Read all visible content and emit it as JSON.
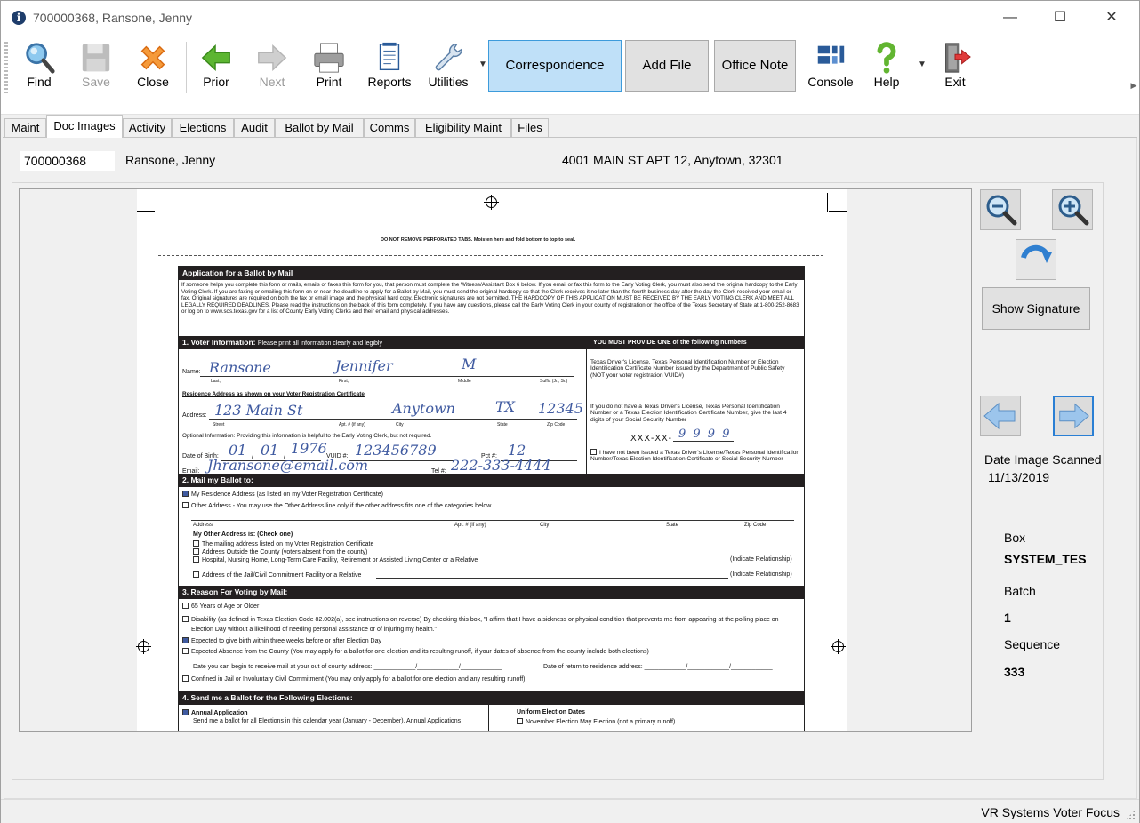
{
  "window": {
    "title": "700000368, Ransone, Jenny",
    "controls": {
      "minimize": "—",
      "maximize": "☐",
      "close": "✕"
    }
  },
  "toolbar": {
    "find": "Find",
    "save": "Save",
    "close": "Close",
    "prior": "Prior",
    "next": "Next",
    "print": "Print",
    "reports": "Reports",
    "utilities": "Utilities",
    "correspondence": "Correspondence",
    "add_file": "Add File",
    "office_note": "Office Note",
    "console": "Console",
    "help": "Help",
    "exit": "Exit"
  },
  "tabs": [
    "Maint",
    "Doc Images",
    "Activity",
    "Elections",
    "Audit",
    "Ballot by Mail",
    "Comms",
    "Eligibility Maint",
    "Files"
  ],
  "active_tab": "Doc Images",
  "voter": {
    "id": "700000368",
    "name": "Ransone, Jenny",
    "address": "4001 MAIN ST APT 12, Anytown, 32301"
  },
  "document": {
    "perforation_note": "DO NOT REMOVE PERFORATED TABS. Moisten here and fold bottom to top to seal.",
    "title": "Application for a Ballot by Mail",
    "intro": "If someone helps you complete this form or mails, emails or faxes this form for you, that person must complete the Witness/Assistant Box 6 below. If you email or fax this form to the Early Voting Clerk, you must also send the original hardcopy to the Early Voting Clerk. If you are faxing or emailing this form on or near the deadline to apply for a Ballot by Mail, you must send the original hardcopy so that the Clerk receives it no later than the fourth business day after the day the Clerk received your email or fax. Original signatures are required on both the fax or email image and the physical hard copy. Electronic signatures are not permitted. THE HARDCOPY OF THIS APPLICATION MUST BE RECEIVED BY THE EARLY VOTING CLERK AND MEET ALL LEGALLY REQUIRED DEADLINES. Please read the instructions on the back of this form completely. If you have any questions, please call the Early Voting Clerk in your county of registration or the office of the Texas Secretary of State at 1-800-252-8683 or log on to www.sos.texas.gov for a list of County Early Voting Clerks and their email and physical addresses.",
    "section1": "1. Voter Information:",
    "section1_note": "Please print all information clearly and legibly",
    "must_provide": "YOU MUST PROVIDE ONE of the following numbers",
    "name_label": "Name:",
    "name_last": "Ransone",
    "name_first": "Jennifer",
    "name_middle": "M",
    "name_sub": [
      "Last,",
      "First,",
      "Middle",
      "Suffix (Jr., Sr.)"
    ],
    "residence_label": "Residence Address as shown on your Voter Registration Certificate",
    "address_label": "Address:",
    "addr_street": "123 Main St",
    "addr_city": "Anytown",
    "addr_state": "TX",
    "addr_zip": "12345",
    "addr_sub": [
      "Street",
      "Apt. # (if any)",
      "City",
      "State",
      "Zip Code"
    ],
    "optional_info": "Optional Information: Providing this information is helpful to the Early Voting Clerk, but not required.",
    "dob_label": "Date of Birth:",
    "dob_m": "01",
    "dob_d": "01",
    "dob_y": "1976",
    "vuid_label": "VUID #:",
    "vuid": "123456789",
    "pct_label": "Pct #:",
    "pct": "12",
    "email_label": "Email:",
    "email": "Jhransone@email.com",
    "tel_label": "Tel #:",
    "tel": "222-333-4444",
    "dl_text": "Texas Driver's License, Texas Personal Identification Number or Election Identification Certificate Number issued by the Department of Public Safety (NOT your voter registration VUID#)",
    "dl_dashes": "__ __ __ __ __ __ __ __",
    "ssn_text": "If you do not have a Texas Driver's License, Texas Personal Identification Number or a Texas Election Identification Certificate Number, give the last 4 digits of your Social Security Number",
    "ssn_prefix": "XXX-XX-",
    "ssn": "9 9 9 9",
    "no_id_text": "I have not been issued a Texas Driver's License/Texas Personal Identification Number/Texas Election Identification Certificate or Social Security Number",
    "section2": "2. Mail my Ballot to:",
    "mail_opt1": "My Residence Address (as listed on my Voter Registration Certificate)",
    "mail_opt2": "Other Address - You may use the Other Address line only if the other address fits one of the categories below.",
    "other_sub": [
      "Address",
      "Apt. # (if any)",
      "City",
      "State",
      "Zip Code"
    ],
    "other_title": "My Other Address is: (Check one)",
    "other_opts": [
      "The mailing address listed on my Voter Registration Certificate",
      "Address Outside the County (voters absent from the county)",
      "Hospital, Nursing Home, Long-Term Care Facility, Retirement or Assisted Living Center or a Relative",
      "Address of the Jail/Civil Commitment Facility or a Relative"
    ],
    "indicate": "(Indicate Relationship)",
    "section3": "3. Reason For Voting by Mail:",
    "reasons": [
      "65 Years of Age or Older",
      "Disability (as defined in Texas Election Code 82.002(a), see instructions on reverse) By checking this box, \"I affirm that I have a sickness or physical condition that prevents me from appearing at the polling place on Election Day without a likelihood of needing personal assistance or of injuring my health.\"",
      "Expected to give birth within three weeks before or after Election Day",
      "Expected Absence from the County (You may apply for a ballot for one election and its resulting runoff, if your dates of absence from the county include both elections)"
    ],
    "date_begin": "Date you can begin to receive mail at your out of county address: ____________/____________/____________",
    "date_return": "Date of return to residence address: ____________/____________/____________",
    "confined": "Confined in Jail or Involuntary Civil Commitment (You may only apply for a ballot for one election and any resulting runoff)",
    "section4": "4. Send me a Ballot for the Following Elections:",
    "annual": "Annual Application",
    "annual_cut": "Send me a ballot for all Elections in this calendar year (January - December). Annual Applications",
    "uniform": "Uniform Election Dates",
    "uniform_cut": "November Election      May Election (not a primary runoff)"
  },
  "side": {
    "show_signature": "Show Signature",
    "date_label": "Date Image Scanned",
    "date_value": "11/13/2019",
    "box_label": "Box",
    "box_value": "SYSTEM_TES",
    "batch_label": "Batch",
    "batch_value": "1",
    "sequence_label": "Sequence",
    "sequence_value": "333"
  },
  "status": {
    "app_name": "VR Systems Voter Focus"
  },
  "colors": {
    "accent": "#3d9bdb",
    "active_button": "#bfe0f8",
    "handwriting": "#3f5aa0"
  }
}
